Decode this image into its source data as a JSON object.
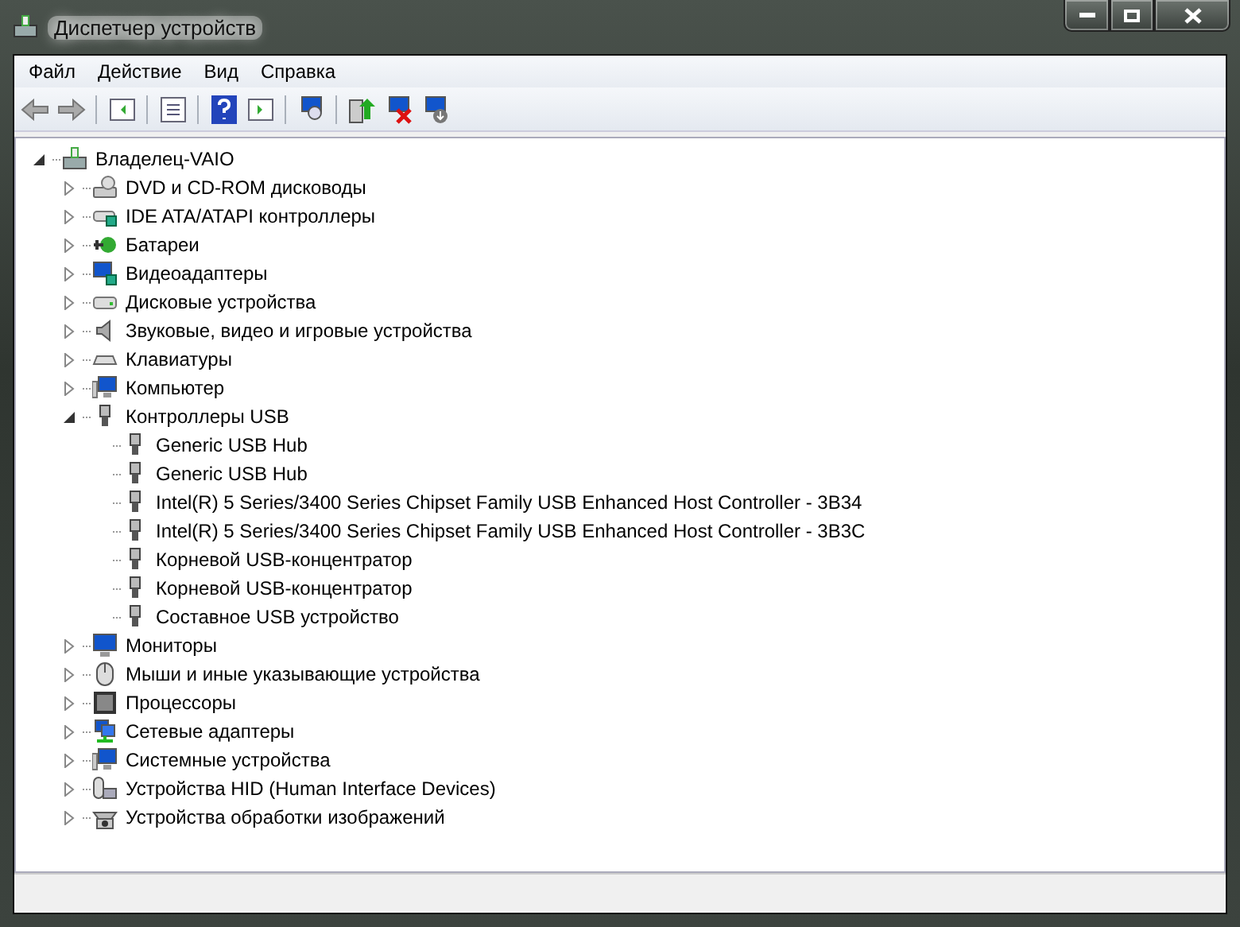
{
  "window": {
    "title": "Диспетчер устройств"
  },
  "menu": [
    "Файл",
    "Действие",
    "Вид",
    "Справка"
  ],
  "tree": {
    "label": "Владелец-VAIO",
    "kind": "computer_root",
    "expanded": true,
    "children": [
      {
        "label": "DVD и CD-ROM дисководы",
        "kind": "optical",
        "expanded": false
      },
      {
        "label": "IDE ATA/ATAPI контроллеры",
        "kind": "controller",
        "expanded": false
      },
      {
        "label": "Батареи",
        "kind": "battery",
        "expanded": false
      },
      {
        "label": "Видеоадаптеры",
        "kind": "display",
        "expanded": false
      },
      {
        "label": "Дисковые устройства",
        "kind": "disk",
        "expanded": false
      },
      {
        "label": "Звуковые, видео и игровые устройства",
        "kind": "audio",
        "expanded": false
      },
      {
        "label": "Клавиатуры",
        "kind": "keyboard",
        "expanded": false
      },
      {
        "label": "Компьютер",
        "kind": "system",
        "expanded": false
      },
      {
        "label": "Контроллеры USB",
        "kind": "usb",
        "expanded": true,
        "children": [
          {
            "label": "Generic USB Hub",
            "kind": "usb"
          },
          {
            "label": "Generic USB Hub",
            "kind": "usb"
          },
          {
            "label": "Intel(R) 5 Series/3400 Series Chipset Family USB Enhanced Host Controller - 3B34",
            "kind": "usb"
          },
          {
            "label": "Intel(R) 5 Series/3400 Series Chipset Family USB Enhanced Host Controller - 3B3C",
            "kind": "usb"
          },
          {
            "label": "Корневой USB-концентратор",
            "kind": "usb"
          },
          {
            "label": "Корневой USB-концентратор",
            "kind": "usb"
          },
          {
            "label": "Составное USB устройство",
            "kind": "usb"
          }
        ]
      },
      {
        "label": "Мониторы",
        "kind": "monitor",
        "expanded": false
      },
      {
        "label": "Мыши и иные указывающие устройства",
        "kind": "mouse",
        "expanded": false
      },
      {
        "label": "Процессоры",
        "kind": "cpu",
        "expanded": false
      },
      {
        "label": "Сетевые адаптеры",
        "kind": "network",
        "expanded": false
      },
      {
        "label": "Системные устройства",
        "kind": "system",
        "expanded": false
      },
      {
        "label": "Устройства HID (Human Interface Devices)",
        "kind": "hid",
        "expanded": false
      },
      {
        "label": "Устройства обработки изображений",
        "kind": "camera",
        "expanded": false
      }
    ]
  }
}
